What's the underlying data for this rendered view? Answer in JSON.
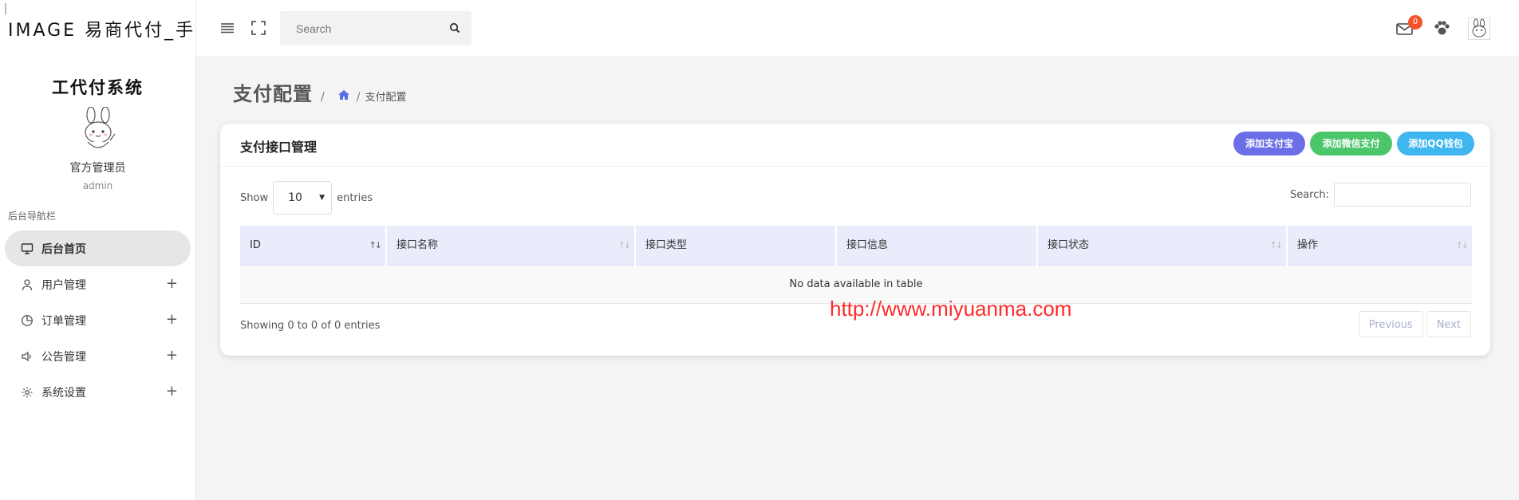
{
  "brand": {
    "text": "IMAGE 易商代付_手"
  },
  "profile": {
    "site_name": "工代付系统",
    "user_name": "官方管理员",
    "user_role": "admin"
  },
  "sidebar": {
    "heading": "后台导航栏",
    "items": [
      {
        "label": "后台首页",
        "icon": "monitor-icon",
        "active": true
      },
      {
        "label": "用户管理",
        "icon": "user-icon",
        "expandable": true
      },
      {
        "label": "订单管理",
        "icon": "pie-chart-icon",
        "expandable": true
      },
      {
        "label": "公告管理",
        "icon": "speaker-icon",
        "expandable": true
      },
      {
        "label": "系统设置",
        "icon": "gear-icon",
        "expandable": true
      }
    ],
    "plus": "+"
  },
  "topbar": {
    "search_placeholder": "Search",
    "notification_count": "0"
  },
  "page": {
    "title": "支付配置",
    "separator": "/",
    "breadcrumb_current": "支付配置"
  },
  "card": {
    "title": "支付接口管理",
    "buttons": [
      {
        "label": "添加支付宝",
        "color": "#6c6ee8"
      },
      {
        "label": "添加微信支付",
        "color": "#4cc66a"
      },
      {
        "label": "添加QQ钱包",
        "color": "#3fb6f0"
      }
    ]
  },
  "table": {
    "show_label": "Show",
    "page_size": "10",
    "entries_label": "entries",
    "search_label": "Search:",
    "columns": [
      {
        "label": "ID",
        "sort": "↑↓"
      },
      {
        "label": "接口名称",
        "sort": "↑↓"
      },
      {
        "label": "接口类型",
        "sort": ""
      },
      {
        "label": "接口信息",
        "sort": ""
      },
      {
        "label": "接口状态",
        "sort": "↑↓"
      },
      {
        "label": "操作",
        "sort": "↑↓"
      }
    ],
    "empty_text": "No data available in table",
    "info": "Showing 0 to 0 of 0 entries",
    "prev_label": "Previous",
    "next_label": "Next"
  },
  "watermark": "http://www.miyuanma.com"
}
